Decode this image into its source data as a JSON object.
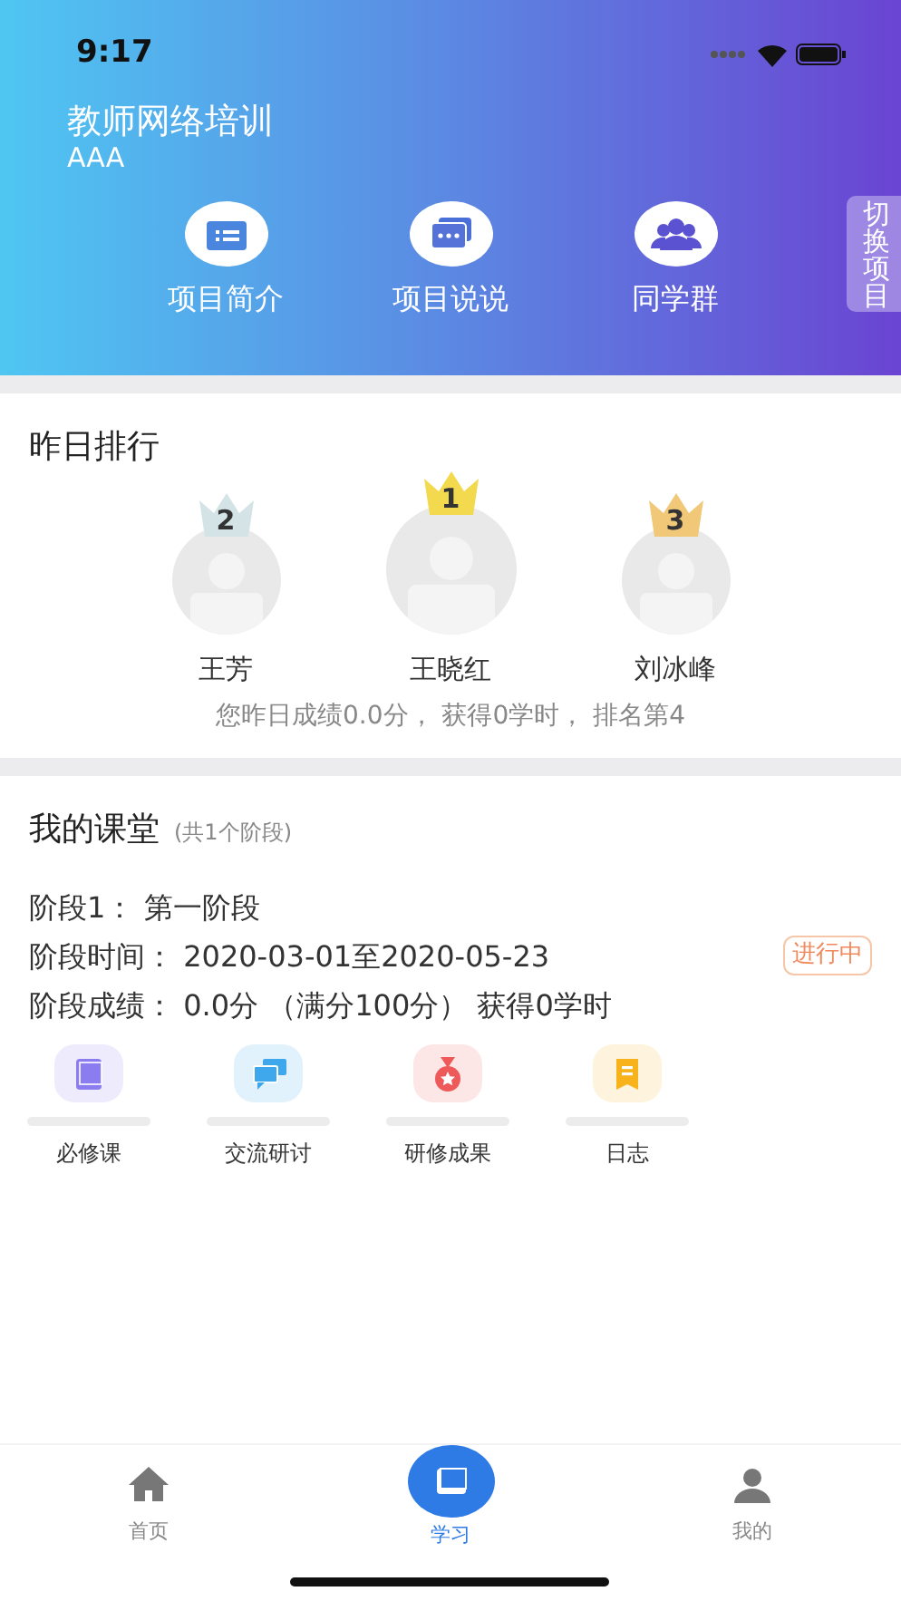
{
  "status_bar": {
    "time": "9:17"
  },
  "header": {
    "title": "教师网络培训",
    "subtitle": "AAA",
    "switch_label": "切换项目",
    "shortcuts": [
      {
        "kind": "folder",
        "label": "项目简介"
      },
      {
        "kind": "chat",
        "label": "项目说说"
      },
      {
        "kind": "group",
        "label": "同学群"
      }
    ]
  },
  "ranking": {
    "title": "昨日排行",
    "podium": [
      {
        "rank": "2",
        "name": "王芳",
        "color": "#d4e4e6"
      },
      {
        "rank": "1",
        "name": "王晓红",
        "color": "#f2d94e"
      },
      {
        "rank": "3",
        "name": "刘冰峰",
        "color": "#f1c878"
      }
    ],
    "summary": "您昨日成绩0.0分， 获得0学时， 排名第4"
  },
  "classroom": {
    "title": "我的课堂",
    "subtitle": "(共1个阶段)",
    "stage": "阶段1： 第一阶段",
    "time": "阶段时间： 2020-03-01至2020-05-23",
    "score": "阶段成绩： 0.0分 （满分100分） 获得0学时",
    "status": "进行中",
    "tiles": [
      {
        "kind": "book",
        "label": "必修课",
        "color": "#8b7cf0"
      },
      {
        "kind": "chat",
        "label": "交流研讨",
        "color": "#3fa8ec"
      },
      {
        "kind": "medal",
        "label": "研修成果",
        "color": "#ee5a5a"
      },
      {
        "kind": "note",
        "label": "日志",
        "color": "#f7b21c"
      }
    ]
  },
  "tab_bar": [
    {
      "kind": "home",
      "label": "首页",
      "selected": false
    },
    {
      "kind": "study",
      "label": "学习",
      "selected": true
    },
    {
      "kind": "me",
      "label": "我的",
      "selected": false
    }
  ]
}
